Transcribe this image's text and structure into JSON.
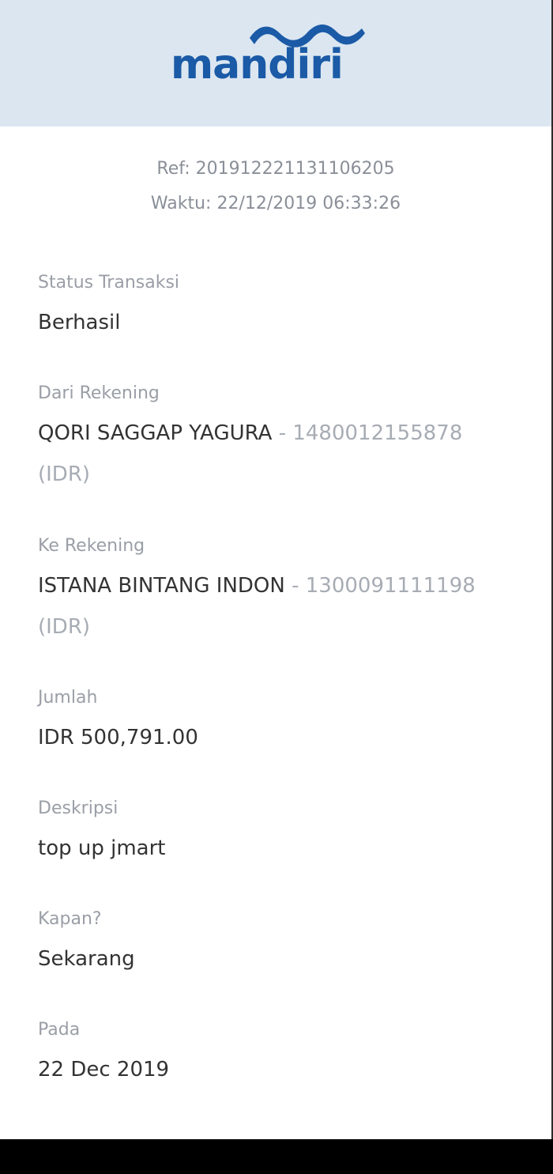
{
  "brand": {
    "name": "mandiri",
    "color": "#1a5aa6"
  },
  "receipt": {
    "ref": "Ref: 201912221131106205",
    "time": "Waktu: 22/12/2019 06:33:26"
  },
  "fields": {
    "status": {
      "label": "Status Transaksi",
      "value": "Berhasil"
    },
    "from": {
      "label": "Dari Rekening",
      "name": "QORI SAGGAP YAGURA",
      "account": " - 1480012155878 (IDR)"
    },
    "to": {
      "label": "Ke Rekening",
      "name": "ISTANA BINTANG INDON",
      "account": " - 1300091111198 (IDR)"
    },
    "amount": {
      "label": "Jumlah",
      "value": "IDR 500,791.00"
    },
    "description": {
      "label": "Deskripsi",
      "value": "top up jmart"
    },
    "when": {
      "label": "Kapan?",
      "value": "Sekarang"
    },
    "date": {
      "label": "Pada",
      "value": "22 Dec 2019"
    }
  }
}
